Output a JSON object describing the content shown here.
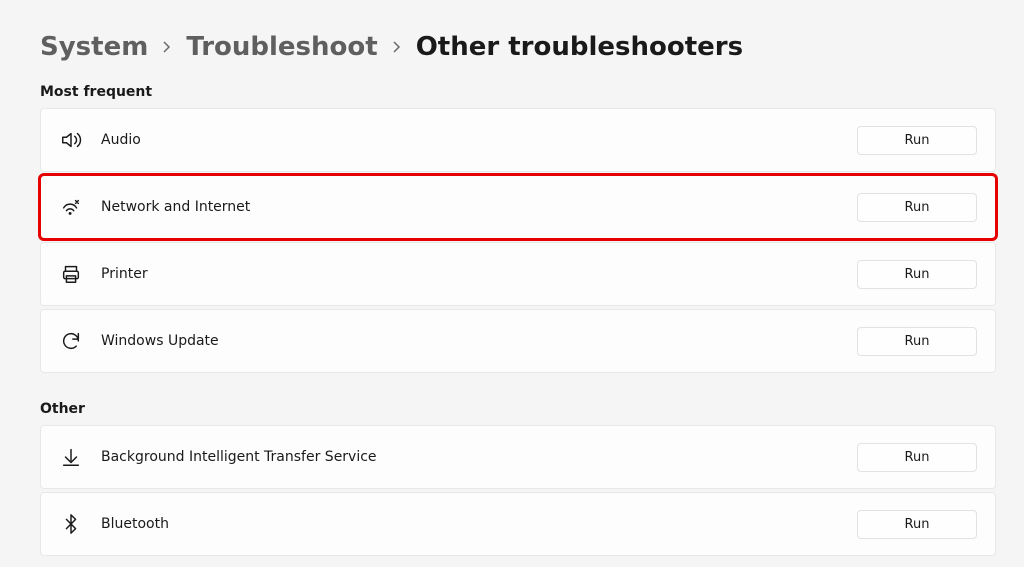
{
  "breadcrumb": {
    "level1": "System",
    "level2": "Troubleshoot",
    "current": "Other troubleshooters"
  },
  "sections": {
    "most_frequent": {
      "label": "Most frequent",
      "items": [
        {
          "icon": "audio-icon",
          "label": "Audio",
          "action": "Run"
        },
        {
          "icon": "network-icon",
          "label": "Network and Internet",
          "action": "Run",
          "highlighted": true
        },
        {
          "icon": "printer-icon",
          "label": "Printer",
          "action": "Run"
        },
        {
          "icon": "update-icon",
          "label": "Windows Update",
          "action": "Run"
        }
      ]
    },
    "other": {
      "label": "Other",
      "items": [
        {
          "icon": "download-icon",
          "label": "Background Intelligent Transfer Service",
          "action": "Run"
        },
        {
          "icon": "bluetooth-icon",
          "label": "Bluetooth",
          "action": "Run"
        }
      ]
    }
  }
}
